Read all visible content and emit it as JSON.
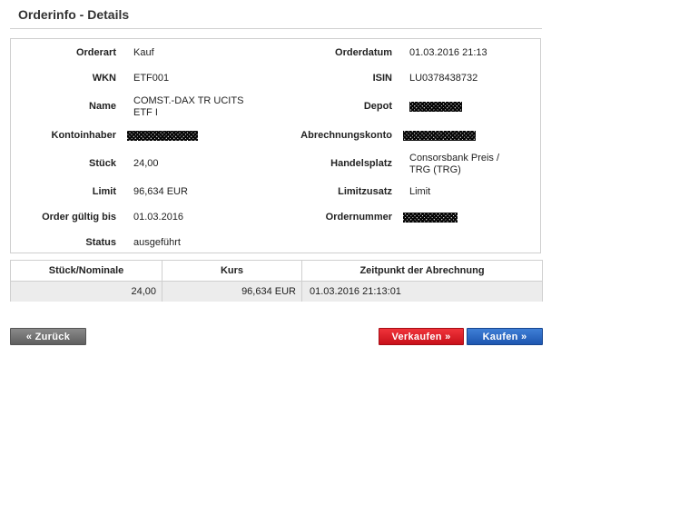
{
  "page": {
    "title": "Orderinfo - Details"
  },
  "details": {
    "orderart": {
      "label": "Orderart",
      "value": "Kauf"
    },
    "orderdatum": {
      "label": "Orderdatum",
      "value": "01.03.2016 21:13"
    },
    "wkn": {
      "label": "WKN",
      "value": "ETF001"
    },
    "isin": {
      "label": "ISIN",
      "value": "LU0378438732"
    },
    "name": {
      "label": "Name",
      "value_line1": "COMST.-DAX TR UCITS",
      "value_line2": "ETF I"
    },
    "depot": {
      "label": "Depot"
    },
    "kontoinhaber": {
      "label": "Kontoinhaber"
    },
    "abrechnungskonto": {
      "label": "Abrechnungskonto"
    },
    "stueck": {
      "label": "Stück",
      "value": "24,00"
    },
    "handelsplatz": {
      "label": "Handelsplatz",
      "value_line1": "Consorsbank Preis /",
      "value_line2": "TRG (TRG)"
    },
    "limit": {
      "label": "Limit",
      "value": "96,634 EUR"
    },
    "limitzusatz": {
      "label": "Limitzusatz",
      "value": "Limit"
    },
    "gueltig_bis": {
      "label": "Order gültig bis",
      "value": "01.03.2016"
    },
    "ordernummer": {
      "label": "Ordernummer"
    },
    "status": {
      "label": "Status",
      "value": "ausgeführt"
    }
  },
  "summary": {
    "headers": [
      "Stück/Nominale",
      "Kurs",
      "Zeitpunkt der Abrechnung"
    ],
    "row": [
      "24,00",
      "96,634 EUR",
      "01.03.2016 21:13:01"
    ]
  },
  "buttons": {
    "back": "« Zurück",
    "sell": "Verkaufen »",
    "buy": "Kaufen »"
  },
  "colors": {
    "sell": "#d91f27",
    "buy": "#2a66c2",
    "back": "#747474"
  }
}
